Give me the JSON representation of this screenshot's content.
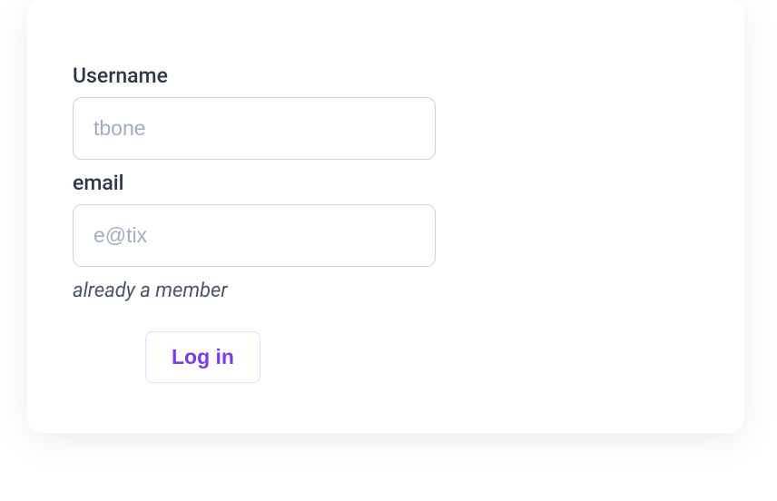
{
  "form": {
    "username": {
      "label": "Username",
      "placeholder": "tbone",
      "value": ""
    },
    "email": {
      "label": "email",
      "placeholder": "e@tix",
      "value": ""
    },
    "hint": "already a member",
    "login_button": "Log in"
  }
}
